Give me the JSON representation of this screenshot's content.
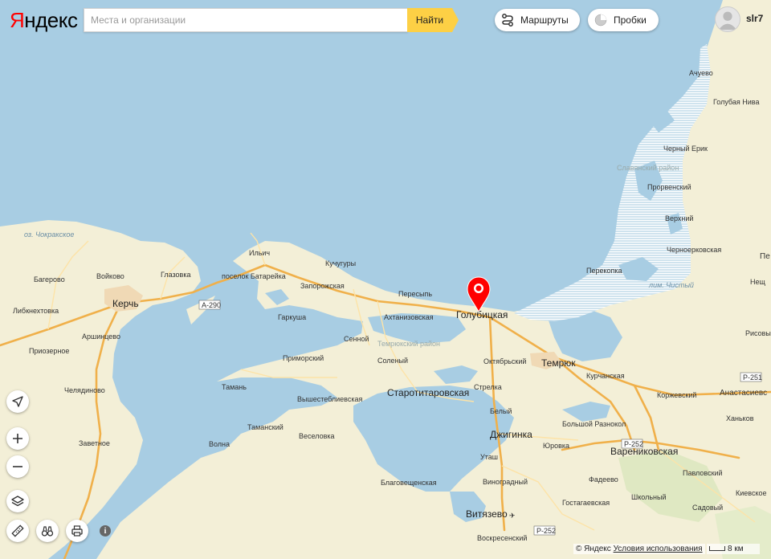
{
  "header": {
    "logo_first": "Я",
    "logo_rest": "ндекс",
    "search_placeholder": "Места и организации",
    "find_label": "Найти",
    "routes_label": "Маршруты",
    "traffic_label": "Пробки",
    "username": "slr7"
  },
  "map": {
    "places": {
      "kerch": "Керчь",
      "bagerovo": "Багерово",
      "voykovo": "Войково",
      "glazovka": "Глазовка",
      "libknekhtovka": "Либкнехтовка",
      "arshintsevo": "Аршинцево",
      "priozernoe": "Приозерное",
      "chelyadinovo": "Челядиново",
      "zavetnoe": "Заветное",
      "lake_chokrak": "оз. Чокракское",
      "a290": "А-290",
      "ilich": "Ильич",
      "batareyka": "поселок Батарейка",
      "kuchugury": "Кучугуры",
      "zaporozhskaya": "Запорожская",
      "peresyp": "Пересыпь",
      "golubitskaya": "Голубицкая",
      "akhtanizovskaya": "Ахтанизовская",
      "garkusha": "Гаркуша",
      "sennoy": "Сенной",
      "temryuk_district": "Темрюкский район",
      "primorsky": "Приморский",
      "soleny": "Соленый",
      "taman": "Тамань",
      "vyshestebliyevskaya": "Вышестеблиевская",
      "starotitarovskaya": "Старотитаровская",
      "tamansky": "Таманский",
      "veselovka": "Веселовка",
      "volna": "Волна",
      "blagoveshchenskaya": "Благовещенская",
      "vinogradny": "Виноградный",
      "vityazevo": "Витязево",
      "voskresensky": "Воскресенский",
      "utash": "Уташ",
      "dzhiginka": "Джигинка",
      "bely": "Белый",
      "strelka": "Стрелка",
      "oktyabrsky": "Октябрьский",
      "temryuk": "Темрюк",
      "kurchanskaya": "Курчанская",
      "perekopka": "Перекопка",
      "bolshoy_raznokol": "Большой Разнокол",
      "yurovka": "Юровка",
      "varenikovskaya": "Варениковская",
      "r252_a": "Р-252",
      "r252_b": "Р-252",
      "r251": "Р-251",
      "fadeevo": "Фадеево",
      "gostagaevskaya": "Гостагаевская",
      "shkolny": "Школьный",
      "pavlovsky": "Павловский",
      "sadovy": "Садовый",
      "kievskoe": "Киевское",
      "korzhevsky": "Коржевский",
      "anastasievskaya": "Анастасиевс",
      "khankov": "Ханьков",
      "risovy": "Рисовый",
      "neshch": "Нещ",
      "pe": "Пе",
      "achuevo": "Ачуево",
      "golubaya_niva": "Голубая Нива",
      "cherny_erik": "Черный Ерик",
      "slavyansky_district": "Славянский район",
      "prorvenskiy": "Прорвенский",
      "verkhniy": "Верхний",
      "chernoerkovskaya": "Черноерковская",
      "lake_chisty": "лим. Чистый"
    }
  },
  "footer": {
    "copyright": "© Яндекс",
    "terms": "Условия использования",
    "scale_label": "8 км"
  }
}
